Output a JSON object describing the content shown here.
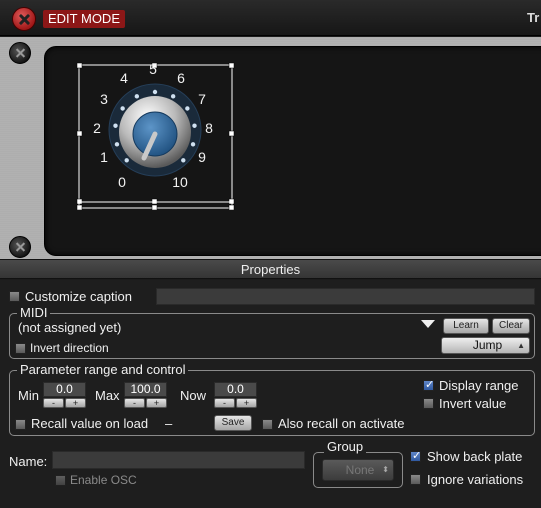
{
  "topbar": {
    "edit_mode_label": "EDIT MODE",
    "right_label": "Tr"
  },
  "knob": {
    "ticks": [
      "0",
      "1",
      "2",
      "3",
      "4",
      "5",
      "6",
      "7",
      "8",
      "9",
      "10"
    ],
    "accent": "#2f6fa6"
  },
  "properties": {
    "header": "Properties",
    "customize_caption": {
      "label": "Customize caption",
      "checked": false,
      "value": ""
    },
    "midi": {
      "title": "MIDI",
      "assignment": "(not assigned yet)",
      "dropdown_icon": "triangle-down-icon",
      "learn_label": "Learn",
      "clear_label": "Clear",
      "invert_direction_label": "Invert direction",
      "invert_direction_checked": false,
      "mode_value": "Jump"
    },
    "range": {
      "title": "Parameter range and control",
      "min_label": "Min",
      "min_value": "0.0",
      "max_label": "Max",
      "max_value": "100.0",
      "now_label": "Now",
      "now_value": "0.0",
      "minus": "-",
      "plus": "+",
      "display_range_label": "Display range",
      "display_range_checked": true,
      "invert_value_label": "Invert value",
      "invert_value_checked": false,
      "recall_label": "Recall value on load",
      "recall_checked": false,
      "recall_value": "–",
      "save_label": "Save",
      "recall_activate_label": "Also recall on activate",
      "recall_activate_checked": false
    },
    "name": {
      "label": "Name:",
      "value": ""
    },
    "enable_osc": {
      "label": "Enable OSC",
      "checked": false
    },
    "group": {
      "title": "Group",
      "value": "None"
    },
    "show_back_plate": {
      "label": "Show back plate",
      "checked": true
    },
    "ignore_variations": {
      "label": "Ignore variations",
      "checked": false
    }
  }
}
